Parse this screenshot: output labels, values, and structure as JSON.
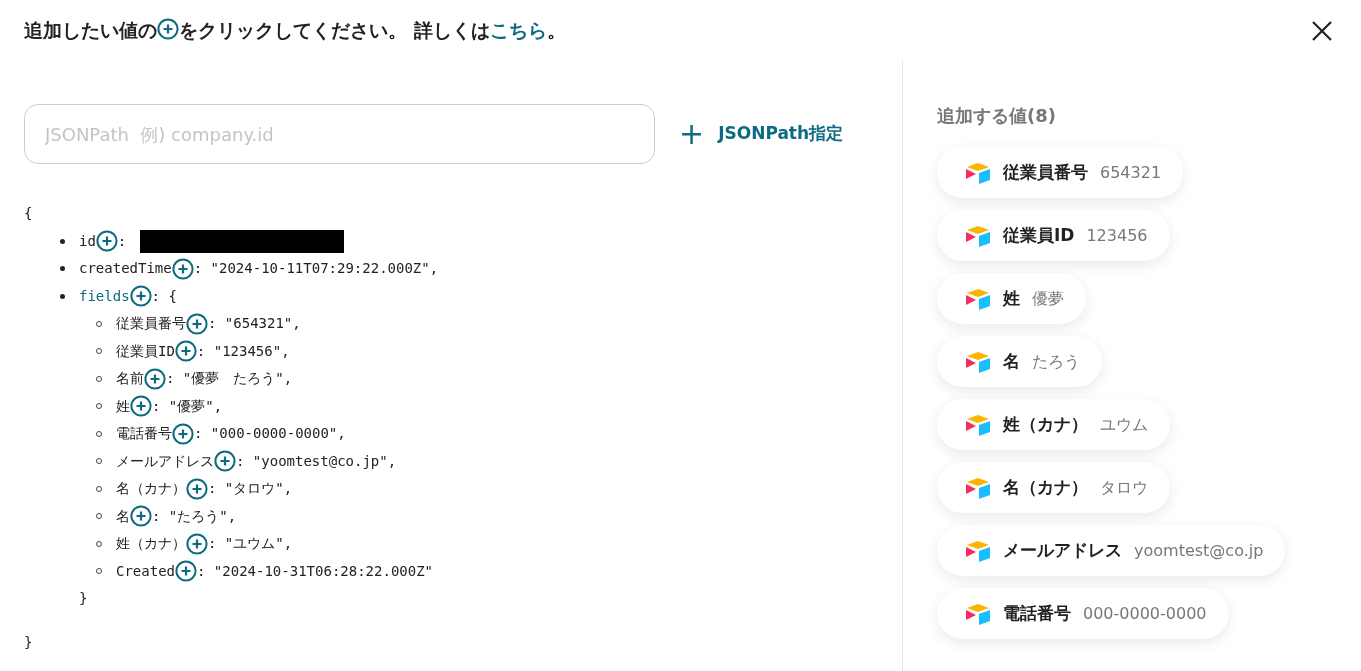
{
  "instruction": {
    "before": "追加したい値の",
    "after": "をクリックしてください。 詳しくは",
    "link": "こちら",
    "end": "。"
  },
  "search": {
    "placeholder": "JSONPath  例) company.id"
  },
  "jsonpath_button": {
    "icon": "+",
    "label": "JSONPath指定"
  },
  "tree": {
    "open": "{",
    "close": "}",
    "items": [
      {
        "key": "id",
        "kind": "redacted",
        "value": ":"
      },
      {
        "key": "createdTime",
        "kind": "value",
        "value": ": \"2024-10-11T07:29:22.000Z\","
      },
      {
        "key": "fields",
        "kind": "object",
        "value": ": {",
        "close": "}",
        "children": [
          {
            "key": "従業員番号",
            "kind": "value",
            "value": ": \"654321\","
          },
          {
            "key": "従業員ID",
            "kind": "value",
            "value": ": \"123456\","
          },
          {
            "key": "名前",
            "kind": "value",
            "value": ": \"優夢　たろう\","
          },
          {
            "key": "姓",
            "kind": "value",
            "value": ": \"優夢\","
          },
          {
            "key": "電話番号",
            "kind": "value",
            "value": ": \"000-0000-0000\","
          },
          {
            "key": "メールアドレス",
            "kind": "value",
            "value": ": \"yoomtest@co.jp\","
          },
          {
            "key": "名（カナ）",
            "kind": "value",
            "value": ": \"タロウ\","
          },
          {
            "key": "名",
            "kind": "value",
            "value": ": \"たろう\","
          },
          {
            "key": "姓（カナ）",
            "kind": "value",
            "value": ": \"ユウム\","
          },
          {
            "key": "Created",
            "kind": "value",
            "value": ": \"2024-10-31T06:28:22.000Z\""
          }
        ]
      }
    ]
  },
  "added": {
    "title": "追加する値(8)",
    "chips": [
      {
        "label": "従業員番号",
        "value": "654321"
      },
      {
        "label": "従業員ID",
        "value": "123456"
      },
      {
        "label": "姓",
        "value": "優夢"
      },
      {
        "label": "名",
        "value": "たろう"
      },
      {
        "label": "姓（カナ）",
        "value": "ユウム"
      },
      {
        "label": "名（カナ）",
        "value": "タロウ"
      },
      {
        "label": "メールアドレス",
        "value": "yoomtest@co.jp"
      },
      {
        "label": "電話番号",
        "value": "000-0000-0000"
      }
    ]
  }
}
